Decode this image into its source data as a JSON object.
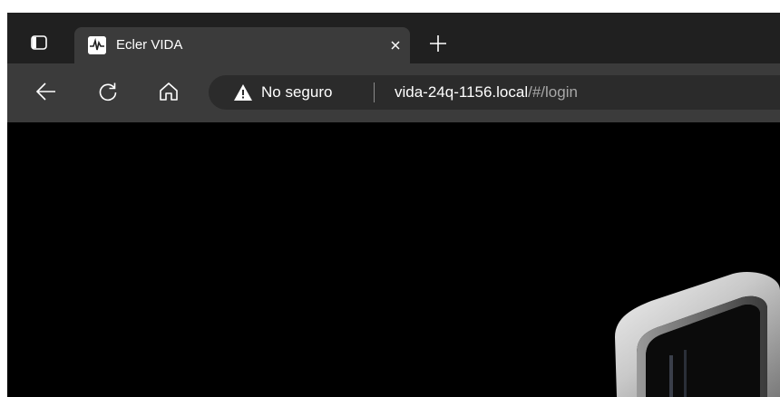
{
  "window": {
    "tabs": [
      {
        "favicon": "waveform-icon",
        "title": "Ecler VIDA",
        "close_icon": "close-icon"
      }
    ],
    "tab_actions_icon": "tab-actions-icon",
    "new_tab_icon": "plus-icon"
  },
  "toolbar": {
    "back_icon": "arrow-left-icon",
    "refresh_icon": "refresh-icon",
    "home_icon": "home-icon"
  },
  "address_bar": {
    "security_icon": "warning-icon",
    "security_label": "No seguro",
    "url_host": "vida-24q-1156.local",
    "url_path": "/#/login"
  },
  "content": {
    "background_color": "#000000",
    "image": "device-hardware-image"
  },
  "colors": {
    "tabstrip": "#202020",
    "active_tab": "#3b3b3b",
    "address_field": "#2b2b2b"
  }
}
